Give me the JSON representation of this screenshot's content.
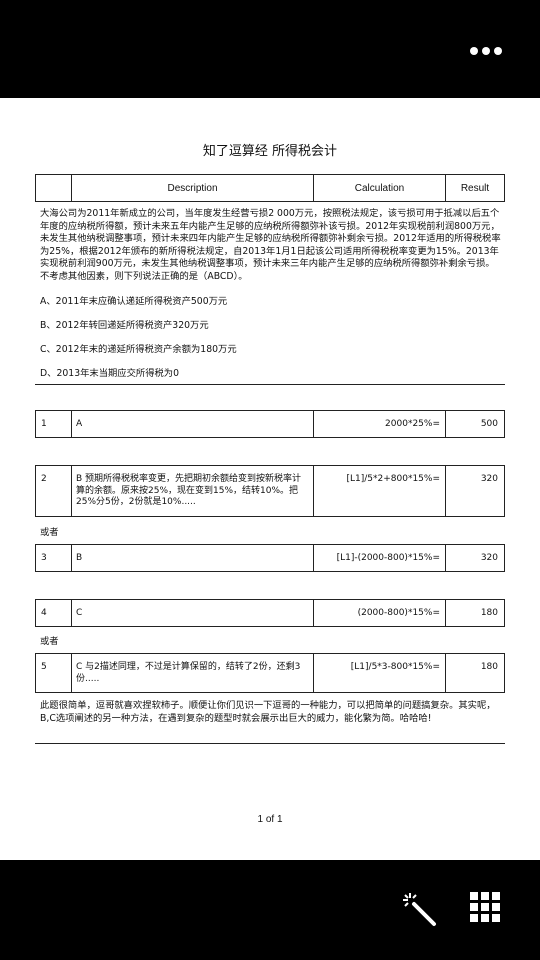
{
  "page": {
    "title": "知了逗算经 所得税会计",
    "header": {
      "description": "Description",
      "calculation": "Calculation",
      "result": "Result"
    },
    "question": "大海公司为2011年新成立的公司，当年度发生经营亏损2 000万元，按照税法规定，该亏损可用于抵减以后五个年度的应纳税所得额，预计未来五年内能产生足够的应纳税所得额弥补该亏损。2012年实现税前利润800万元，未发生其他纳税调整事项，预计未来四年内能产生足够的应纳税所得额弥补剩余亏损。2012年适用的所得税税率为25%，根据2012年颁布的新所得税法规定，自2013年1月1日起该公司适用所得税税率变更为15%。2013年实现税前利润900万元，未发生其他纳税调整事项，预计未来三年内能产生足够的应纳税所得额弥补剩余亏损。不考虑其他因素，则下列说法正确的是（ABCD）。",
    "options": [
      "A、2011年末应确认递延所得税资产500万元",
      "B、2012年转回递延所得税资产320万元",
      "C、2012年末的递延所得税资产余额为180万元",
      "D、2013年末当期应交所得税为0"
    ],
    "rows": [
      {
        "no": "1",
        "label": "A",
        "calc": "2000*25%=",
        "result": "500"
      },
      {
        "no": "2",
        "label": "B 预期所得税税率变更，先把期初余额给变到按新税率计算的余额。原来按25%，现在变到15%，结转10%。把25%分5份，2份就是10%.....",
        "calc": "[L1]/5*2+800*15%=",
        "result": "320"
      },
      {
        "no": "3",
        "label": "B",
        "calc": "[L1]-(2000-800)*15%=",
        "result": "320"
      },
      {
        "no": "4",
        "label": "C",
        "calc": "(2000-800)*15%=",
        "result": "180"
      },
      {
        "no": "5",
        "label": "C 与2描述同理，不过是计算保留的，结转了2份，还剩3份.....",
        "calc": "[L1]/5*3-800*15%=",
        "result": "180"
      }
    ],
    "or_text": "或者",
    "closing": "此题很简单，逗哥就喜欢捏软柿子。顺便让你们见识一下逗哥的一种能力，可以把简单的问题搞复杂。其实呢，B,C选项阐述的另一种方法，在遇到复杂的题型时就会展示出巨大的威力，能化繁为简。哈哈哈!",
    "page_indicator": "1 of 1"
  },
  "icons": {
    "more": "more-horizontal-icon",
    "magic": "magic-wand-icon",
    "grid": "grid-icon"
  }
}
